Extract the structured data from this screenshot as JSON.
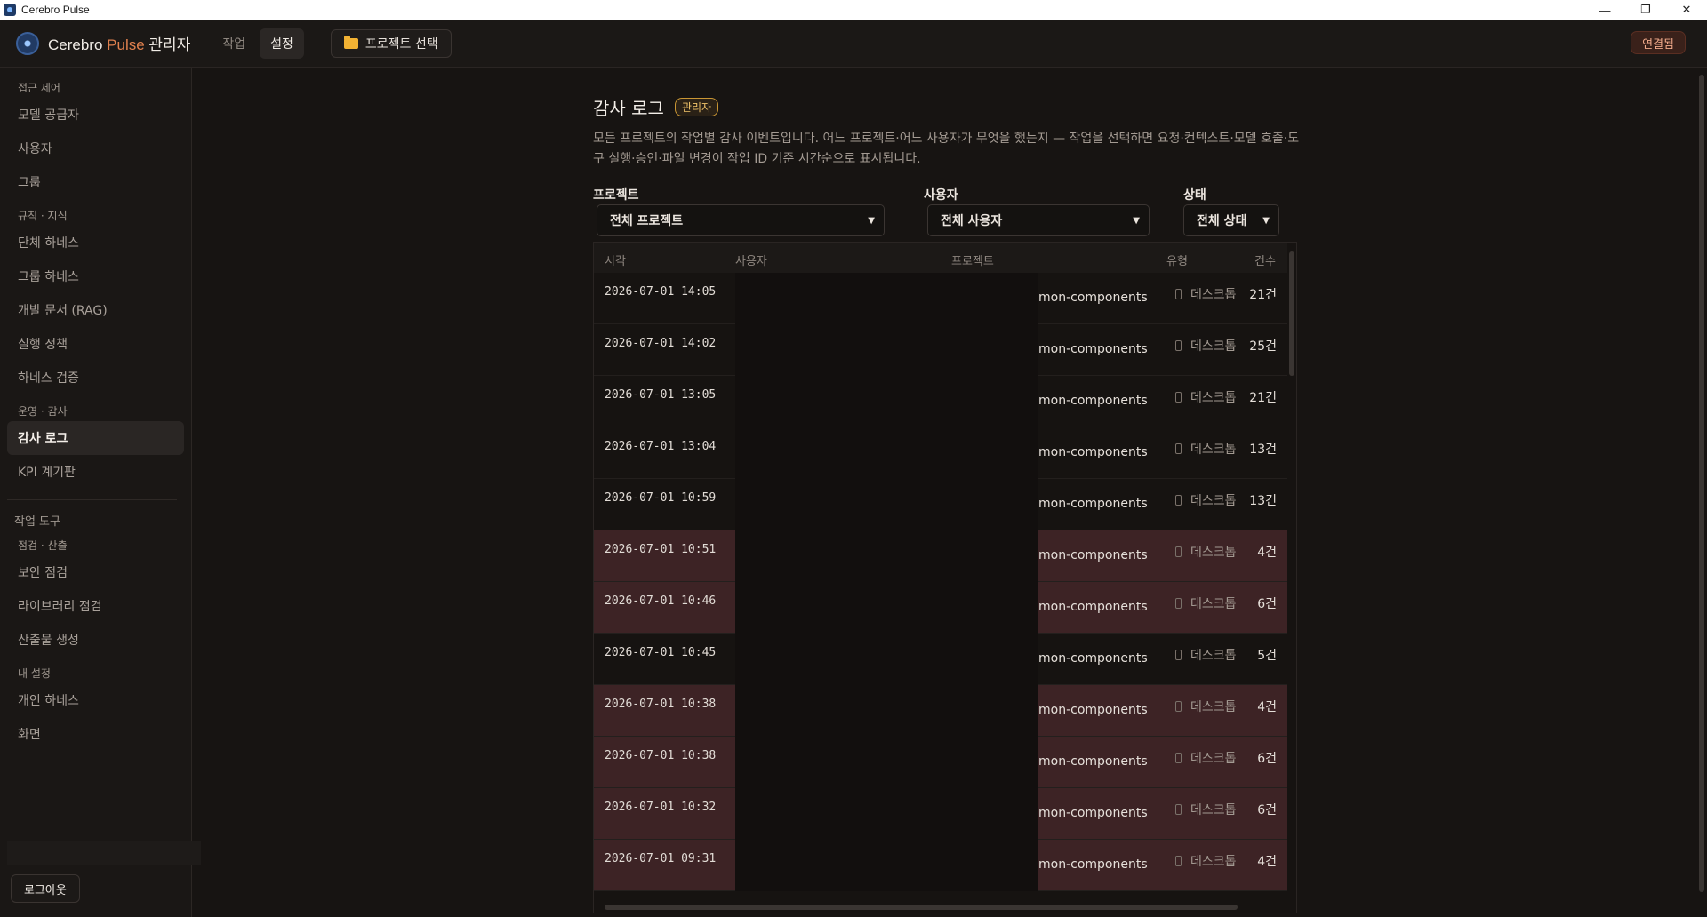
{
  "window": {
    "title": "Cerebro Pulse",
    "minimize": "—",
    "maximize": "❐",
    "close": "✕"
  },
  "header": {
    "brand_main": "Cerebro",
    "brand_accent": "Pulse",
    "brand_suffix": "관리자",
    "tabs": [
      {
        "label": "작업",
        "active": false
      },
      {
        "label": "설정",
        "active": true
      }
    ],
    "project_button": "프로젝트 선택",
    "status": "연결됨"
  },
  "sidebar": {
    "groups": [
      {
        "section": "접근 제어",
        "items": [
          "모델 공급자",
          "사용자",
          "그룹"
        ]
      },
      {
        "section": "규칙 · 지식",
        "items": [
          "단체 하네스",
          "그룹 하네스",
          "개발 문서 (RAG)",
          "실행 정책",
          "하네스 검증"
        ]
      },
      {
        "section": "운영 · 감사",
        "items": [
          "감사 로그",
          "KPI 계기판"
        ]
      }
    ],
    "tools_title": "작업 도구",
    "tool_groups": [
      {
        "section": "점검 · 산출",
        "items": [
          "보안 점검",
          "라이브러리 점검",
          "산출물 생성"
        ]
      },
      {
        "section": "내 설정",
        "items": [
          "개인 하네스",
          "화면"
        ]
      }
    ],
    "active_item": "감사 로그",
    "logout": "로그아웃"
  },
  "main": {
    "title": "감사 로그",
    "badge": "관리자",
    "description": "모든 프로젝트의 작업별 감사 이벤트입니다. 어느 프로젝트·어느 사용자가 무엇을 했는지 — 작업을 선택하면 요청·컨텍스트·모델 호출·도구 실행·승인·파일 변경이 작업 ID 기준 시간순으로 표시됩니다.",
    "filters": {
      "project": {
        "label": "프로젝트",
        "value": "전체 프로젝트"
      },
      "user": {
        "label": "사용자",
        "value": "전체 사용자"
      },
      "status": {
        "label": "상태",
        "value": "전체 상태"
      }
    },
    "table": {
      "columns": [
        "시각",
        "사용자",
        "프로젝트",
        "유형",
        "건수"
      ],
      "rows": [
        {
          "time": "2026-07-01 14:05",
          "project": "mon-components",
          "type": "데스크톱",
          "count": "21건",
          "flag": false
        },
        {
          "time": "2026-07-01 14:02",
          "project": "mon-components",
          "type": "데스크톱",
          "count": "25건",
          "flag": false
        },
        {
          "time": "2026-07-01 13:05",
          "project": "mon-components",
          "type": "데스크톱",
          "count": "21건",
          "flag": false
        },
        {
          "time": "2026-07-01 13:04",
          "project": "mon-components",
          "type": "데스크톱",
          "count": "13건",
          "flag": false
        },
        {
          "time": "2026-07-01 10:59",
          "project": "mon-components",
          "type": "데스크톱",
          "count": "13건",
          "flag": false
        },
        {
          "time": "2026-07-01 10:51",
          "project": "mon-components",
          "type": "데스크톱",
          "count": "4건",
          "flag": true
        },
        {
          "time": "2026-07-01 10:46",
          "project": "mon-components",
          "type": "데스크톱",
          "count": "6건",
          "flag": true
        },
        {
          "time": "2026-07-01 10:45",
          "project": "mon-components",
          "type": "데스크톱",
          "count": "5건",
          "flag": false
        },
        {
          "time": "2026-07-01 10:38",
          "project": "mon-components",
          "type": "데스크톱",
          "count": "4건",
          "flag": true
        },
        {
          "time": "2026-07-01 10:38",
          "project": "mon-components",
          "type": "데스크톱",
          "count": "6건",
          "flag": true
        },
        {
          "time": "2026-07-01 10:32",
          "project": "mon-components",
          "type": "데스크톱",
          "count": "6건",
          "flag": true
        },
        {
          "time": "2026-07-01 09:31",
          "project": "mon-components",
          "type": "데스크톱",
          "count": "4건",
          "flag": true
        }
      ]
    }
  },
  "colors": {
    "accent": "#e0804e",
    "flag_row": "#3d2325",
    "admin_badge": "#f0c36a"
  }
}
